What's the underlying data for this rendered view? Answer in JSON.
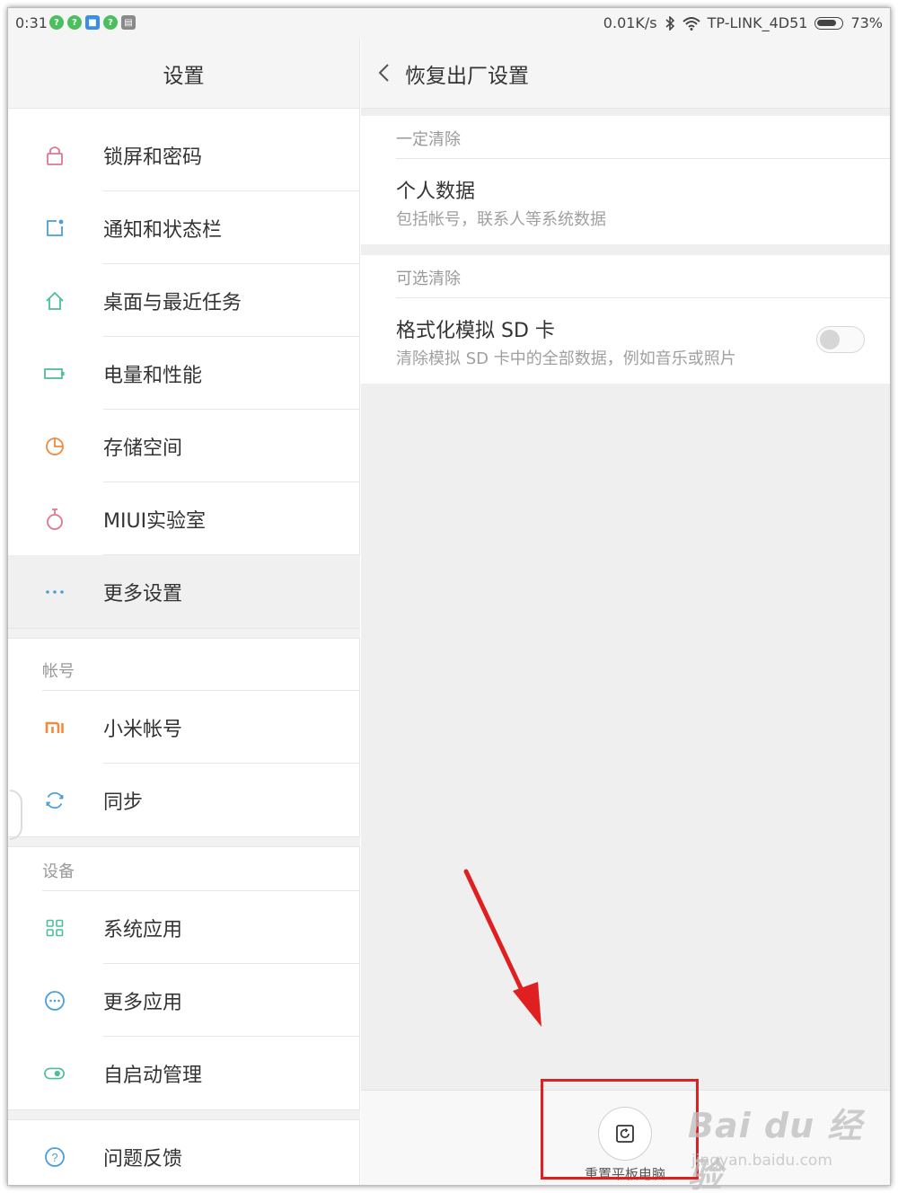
{
  "status_bar": {
    "time": "0:31",
    "net_speed": "0.01K/s",
    "wifi_name": "TP-LINK_4D51",
    "battery": "73%",
    "notif_icons": [
      "green-chat-icon",
      "green-chat-icon",
      "blue-app-icon",
      "green-chat-icon",
      "gray-app-icon"
    ]
  },
  "left": {
    "title": "设置",
    "items_top": [
      {
        "label": "锁屏和密码",
        "icon": "lock-icon"
      },
      {
        "label": "通知和状态栏",
        "icon": "notification-icon"
      },
      {
        "label": "桌面与最近任务",
        "icon": "home-icon"
      },
      {
        "label": "电量和性能",
        "icon": "battery-icon"
      },
      {
        "label": "存储空间",
        "icon": "pie-chart-icon"
      },
      {
        "label": "MIUI实验室",
        "icon": "flask-icon"
      },
      {
        "label": "更多设置",
        "icon": "more-dots-icon"
      }
    ],
    "account_header": "帐号",
    "account_items": [
      {
        "label": "小米帐号",
        "icon": "mi-logo-icon"
      },
      {
        "label": "同步",
        "icon": "sync-icon"
      }
    ],
    "device_header": "设备",
    "device_items": [
      {
        "label": "系统应用",
        "icon": "grid-icon"
      },
      {
        "label": "更多应用",
        "icon": "more-circle-icon"
      },
      {
        "label": "自启动管理",
        "icon": "toggle-icon"
      }
    ],
    "feedback": {
      "label": "问题反馈",
      "icon": "help-icon"
    }
  },
  "right": {
    "title": "恢复出厂设置",
    "section1": "一定清除",
    "personal_title": "个人数据",
    "personal_sub": "包括帐号，联系人等系统数据",
    "section2": "可选清除",
    "sd_title": "格式化模拟 SD 卡",
    "sd_sub": "清除模拟 SD 卡中的全部数据，例如音乐或照片",
    "sd_toggle_on": false,
    "reset_label": "重置平板电脑"
  },
  "watermark": {
    "main": "Bai du 经验",
    "sub": "jingyan.baidu.com"
  },
  "colors": {
    "annotation_red": "#e02020",
    "accent_pink": "#e0768e",
    "accent_blue": "#4a9fd8",
    "accent_green": "#4cbf9a",
    "accent_orange": "#f08a3c"
  }
}
